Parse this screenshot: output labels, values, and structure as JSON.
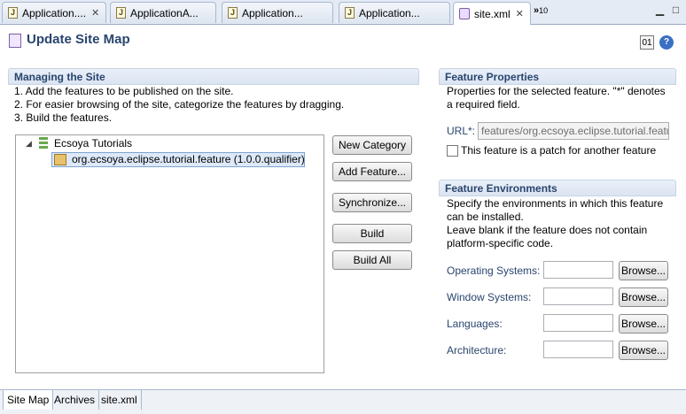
{
  "editor_tabs": [
    {
      "label": "Application....",
      "icon": "java-file-icon"
    },
    {
      "label": "ApplicationA...",
      "icon": "java-file-icon"
    },
    {
      "label": "Application...",
      "icon": "java-file-icon"
    },
    {
      "label": "Application...",
      "icon": "java-file-icon"
    },
    {
      "label": "site.xml",
      "icon": "site-xml-icon",
      "active": true
    }
  ],
  "tab_overflow": {
    "symbol": "»",
    "count": "10"
  },
  "page": {
    "title": "Update Site Map"
  },
  "managing": {
    "title": "Managing the Site",
    "steps": [
      "1. Add the features to be published on the site.",
      "2. For easier browsing of the site, categorize the features by dragging.",
      "3. Build the features."
    ],
    "tree": {
      "category": "Ecsoya Tutorials",
      "feature": "org.ecsoya.eclipse.tutorial.feature (1.0.0.qualifier)"
    },
    "buttons": {
      "new_category": "New Category",
      "add_feature": "Add Feature...",
      "synchronize": "Synchronize...",
      "build": "Build",
      "build_all": "Build All"
    }
  },
  "feature_properties": {
    "title": "Feature Properties",
    "desc1": "Properties for the selected feature.  \"*\" denotes",
    "desc2": "a required field.",
    "url_label": "URL*:",
    "url_value": "features/org.ecsoya.eclipse.tutorial.feature",
    "patch_label": "This feature is a patch for another feature",
    "patch_checked": false
  },
  "feature_env": {
    "title": "Feature Environments",
    "desc": [
      "Specify the environments in which this feature",
      "can be installed.",
      "Leave blank if the feature does not contain",
      "platform-specific code."
    ],
    "rows": [
      {
        "label": "Operating Systems:",
        "value": "",
        "button": "Browse..."
      },
      {
        "label": "Window Systems:",
        "value": "",
        "button": "Browse..."
      },
      {
        "label": "Languages:",
        "value": "",
        "button": "Browse..."
      },
      {
        "label": "Architecture:",
        "value": "",
        "button": "Browse..."
      }
    ]
  },
  "bottom_tabs": [
    "Site Map",
    "Archives",
    "site.xml"
  ],
  "active_bottom_tab": "Site Map"
}
